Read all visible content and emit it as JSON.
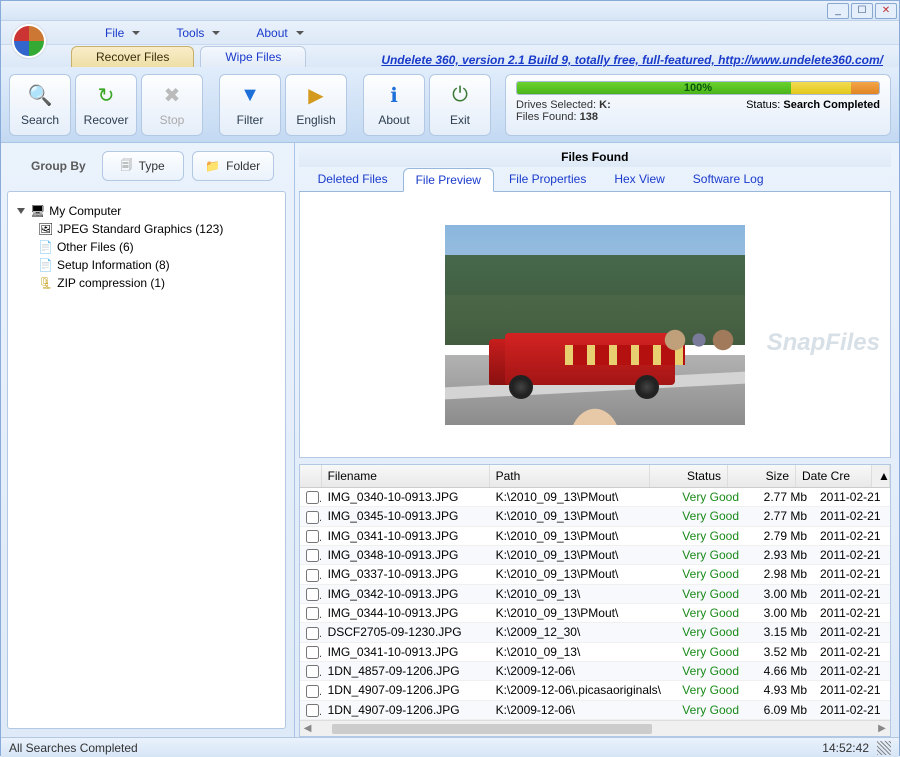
{
  "window": {
    "min": "_",
    "max": "☐",
    "close": "✕"
  },
  "menu": [
    "File",
    "Tools",
    "About"
  ],
  "logo_name": "app-logo",
  "subtabs": {
    "recover": "Recover Files",
    "wipe": "Wipe Files"
  },
  "version_link": "Undelete 360, version 2.1 Build 9, totally free, full-featured, http://www.undelete360.com/",
  "toolbar": {
    "search": "Search",
    "recover": "Recover",
    "stop": "Stop",
    "filter": "Filter",
    "english": "English",
    "about": "About",
    "exit": "Exit"
  },
  "status": {
    "progress": "100%",
    "drives_label": "Drives Selected:",
    "drives_value": "K:",
    "files_label": "Files Found:",
    "files_value": "138",
    "status_label": "Status:",
    "status_value": "Search Completed"
  },
  "group_by": {
    "label": "Group By",
    "type": "Type",
    "folder": "Folder"
  },
  "tree": {
    "root": "My Computer",
    "items": [
      "JPEG Standard Graphics (123)",
      "Other Files (6)",
      "Setup Information (8)",
      "ZIP compression (1)"
    ]
  },
  "files_found_title": "Files Found",
  "content_tabs": [
    "Deleted Files",
    "File Preview",
    "File Properties",
    "Hex View",
    "Software Log"
  ],
  "active_tab": 1,
  "watermark": "SnapFiles",
  "grid": {
    "headers": [
      "",
      "Filename",
      "Path",
      "Status",
      "Size",
      "Date Cre"
    ],
    "rows": [
      {
        "fn": "IMG_0340-10-0913.JPG",
        "path": "K:\\2010_09_13\\PMout\\",
        "status": "Very Good",
        "size": "2.77 Mb",
        "date": "2011-02-21"
      },
      {
        "fn": "IMG_0345-10-0913.JPG",
        "path": "K:\\2010_09_13\\PMout\\",
        "status": "Very Good",
        "size": "2.77 Mb",
        "date": "2011-02-21"
      },
      {
        "fn": "IMG_0341-10-0913.JPG",
        "path": "K:\\2010_09_13\\PMout\\",
        "status": "Very Good",
        "size": "2.79 Mb",
        "date": "2011-02-21"
      },
      {
        "fn": "IMG_0348-10-0913.JPG",
        "path": "K:\\2010_09_13\\PMout\\",
        "status": "Very Good",
        "size": "2.93 Mb",
        "date": "2011-02-21"
      },
      {
        "fn": "IMG_0337-10-0913.JPG",
        "path": "K:\\2010_09_13\\PMout\\",
        "status": "Very Good",
        "size": "2.98 Mb",
        "date": "2011-02-21"
      },
      {
        "fn": "IMG_0342-10-0913.JPG",
        "path": "K:\\2010_09_13\\",
        "status": "Very Good",
        "size": "3.00 Mb",
        "date": "2011-02-21"
      },
      {
        "fn": "IMG_0344-10-0913.JPG",
        "path": "K:\\2010_09_13\\PMout\\",
        "status": "Very Good",
        "size": "3.00 Mb",
        "date": "2011-02-21"
      },
      {
        "fn": "DSCF2705-09-1230.JPG",
        "path": "K:\\2009_12_30\\",
        "status": "Very Good",
        "size": "3.15 Mb",
        "date": "2011-02-21"
      },
      {
        "fn": "IMG_0341-10-0913.JPG",
        "path": "K:\\2010_09_13\\",
        "status": "Very Good",
        "size": "3.52 Mb",
        "date": "2011-02-21"
      },
      {
        "fn": "1DN_4857-09-1206.JPG",
        "path": "K:\\2009-12-06\\",
        "status": "Very Good",
        "size": "4.66 Mb",
        "date": "2011-02-21"
      },
      {
        "fn": "1DN_4907-09-1206.JPG",
        "path": "K:\\2009-12-06\\.picasaoriginals\\",
        "status": "Very Good",
        "size": "4.93 Mb",
        "date": "2011-02-21"
      },
      {
        "fn": "1DN_4907-09-1206.JPG",
        "path": "K:\\2009-12-06\\",
        "status": "Very Good",
        "size": "6.09 Mb",
        "date": "2011-02-21"
      }
    ]
  },
  "statusbar": {
    "left": "All Searches Completed",
    "time": "14:52:42"
  }
}
